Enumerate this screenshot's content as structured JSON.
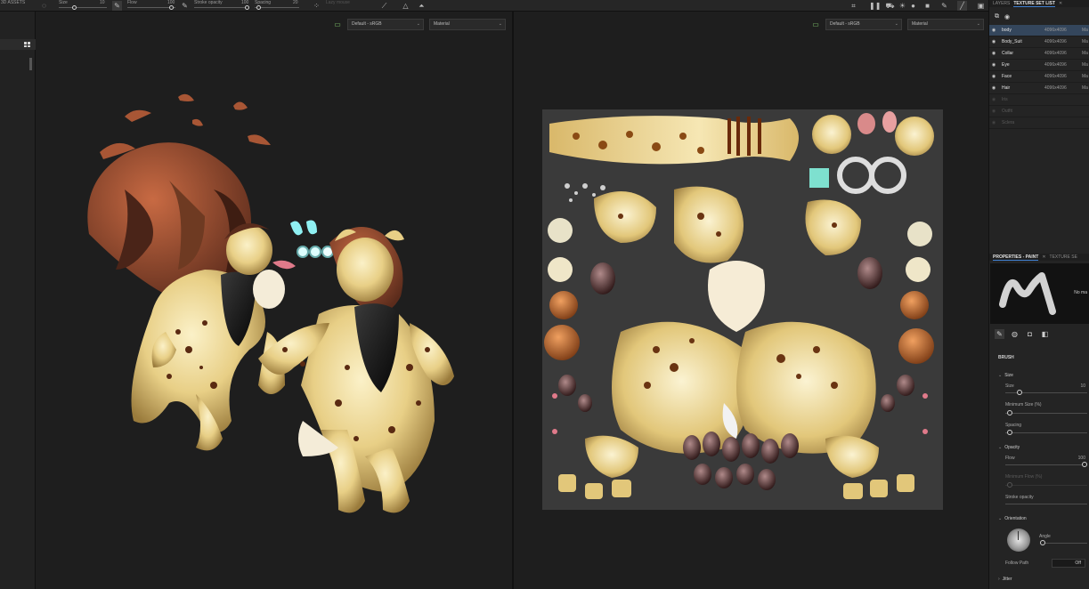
{
  "left_panel": {
    "tab_label": "3D ASSETS"
  },
  "toolbar": {
    "size_label": "Size",
    "size_value": "10",
    "flow_label": "Flow",
    "flow_value": "100",
    "stroke_opacity_label": "Stroke opacity",
    "stroke_opacity_value": "100",
    "spacing_label": "Spacing",
    "spacing_value": "20",
    "lazy_label": "Lazy mouse"
  },
  "viewport_3d": {
    "colorspace": "Default - sRGB",
    "channel": "Material"
  },
  "viewport_2d": {
    "colorspace": "Default - sRGB",
    "channel": "Material"
  },
  "layers_panel": {
    "tabs": [
      "LAYERS",
      "TEXTURE SET LIST"
    ],
    "active_tab": "TEXTURE SET LIST",
    "texture_sets": [
      {
        "name": "body",
        "resolution": "4096x4096",
        "shader": "Ma",
        "selected": true,
        "visible": true
      },
      {
        "name": "Body_Suit",
        "resolution": "4096x4096",
        "shader": "Ma",
        "selected": false,
        "visible": true
      },
      {
        "name": "Collar",
        "resolution": "4096x4096",
        "shader": "Ma",
        "selected": false,
        "visible": true
      },
      {
        "name": "Eye",
        "resolution": "4096x4096",
        "shader": "Ma",
        "selected": false,
        "visible": true
      },
      {
        "name": "Face",
        "resolution": "4096x4096",
        "shader": "Ma",
        "selected": false,
        "visible": true
      },
      {
        "name": "Hair",
        "resolution": "4096x4096",
        "shader": "Ma",
        "selected": false,
        "visible": true
      },
      {
        "name": "Iris",
        "resolution": "",
        "shader": "",
        "selected": false,
        "visible": false
      },
      {
        "name": "Outfit",
        "resolution": "",
        "shader": "",
        "selected": false,
        "visible": false
      },
      {
        "name": "Sclera",
        "resolution": "",
        "shader": "",
        "selected": false,
        "visible": false
      }
    ]
  },
  "properties_panel": {
    "tabs": [
      "PROPERTIES - PAINT",
      "TEXTURE SE"
    ],
    "active_tab": "PROPERTIES - PAINT",
    "preview_note": "No ma",
    "brush_section": "BRUSH",
    "size_group": "Size",
    "size_label": "Size",
    "size_value": "10",
    "size_fraction": 0.15,
    "min_size_label": "Minimum Size (%)",
    "min_size_fraction": 0.02,
    "spacing_label": "Spacing",
    "spacing_fraction": 0.02,
    "opacity_group": "Opacity",
    "flow_label": "Flow",
    "flow_value": "100",
    "flow_fraction": 1.0,
    "min_flow_label": "Minimum Flow (%)",
    "min_flow_fraction": 0.02,
    "stroke_opacity_label": "Stroke opacity",
    "orientation_group": "Orientation",
    "angle_label": "Angle",
    "follow_path_label": "Follow Path",
    "follow_path_value": "Off",
    "jitter_group": "Jitter"
  },
  "colors": {
    "accent": "#3f7fd0",
    "selected_row": "#34465c",
    "monitor_icon": "#7fc36a"
  },
  "icons": {
    "toolbar": [
      "brush-icon",
      "grid-icon",
      "pause-icon",
      "camera-icon",
      "light-icon",
      "sphere-icon",
      "cube-icon",
      "video-icon",
      "pen-icon",
      "screenshot-icon"
    ],
    "texture_set": [
      "filter-icon",
      "eye-icon"
    ],
    "properties": [
      "brush-icon",
      "sphere-icon",
      "stencil-icon",
      "material-icon"
    ]
  }
}
